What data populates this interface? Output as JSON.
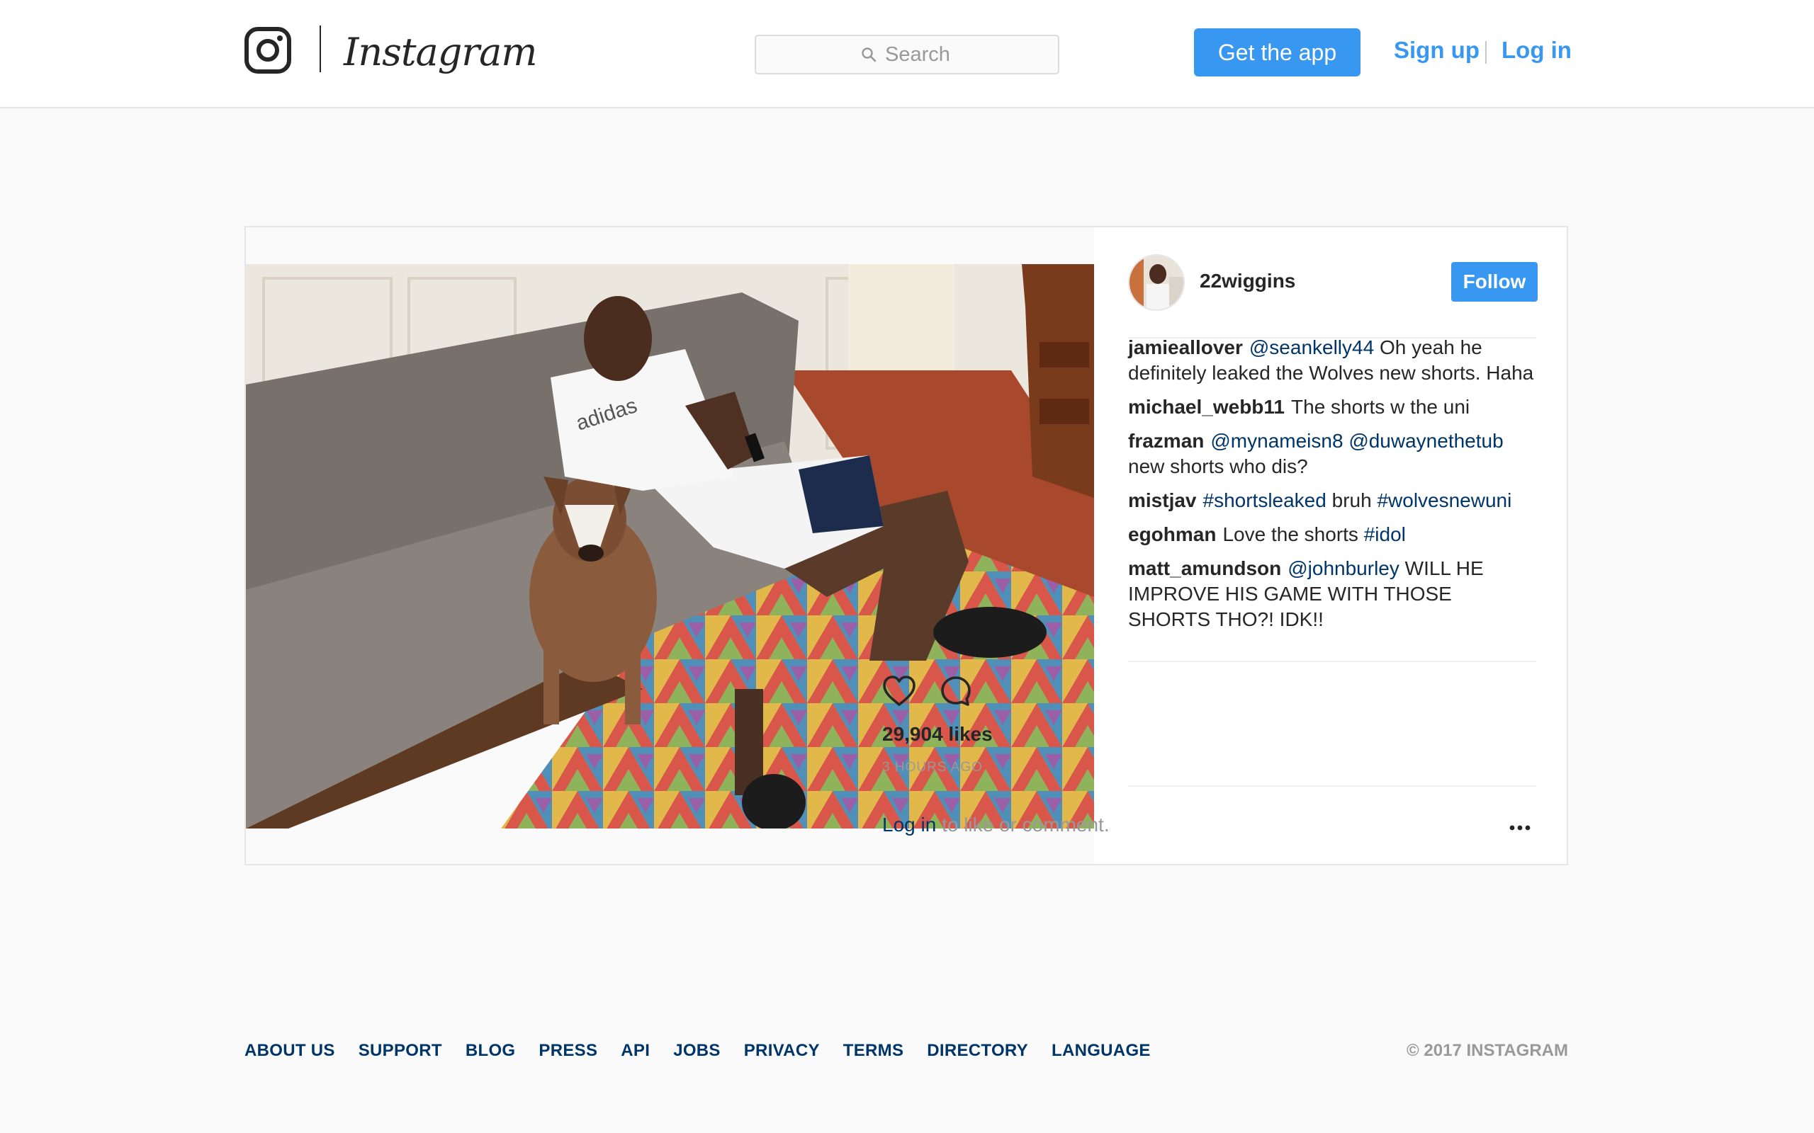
{
  "header": {
    "brand": "Instagram",
    "search_placeholder": "Search",
    "get_app_label": "Get the app",
    "signup_label": "Sign up",
    "login_label": "Log in"
  },
  "post": {
    "author": "22wiggins",
    "follow_label": "Follow",
    "image_logo_text": "adidas",
    "comments": [
      {
        "user": "jamieallover",
        "parts": [
          {
            "t": "@seankelly44",
            "link": true
          },
          {
            "t": " Oh yeah he definitely leaked the Wolves new shorts. Haha",
            "link": false
          }
        ]
      },
      {
        "user": "michael_webb11",
        "parts": [
          {
            "t": "The shorts w the uni",
            "link": false
          }
        ]
      },
      {
        "user": "frazman",
        "parts": [
          {
            "t": "@mynameisn8",
            "link": true
          },
          {
            "t": " ",
            "link": false
          },
          {
            "t": "@duwaynethetub",
            "link": true
          },
          {
            "t": " new shorts who dis?",
            "link": false
          }
        ]
      },
      {
        "user": "mistjav",
        "parts": [
          {
            "t": "#shortsleaked",
            "link": true
          },
          {
            "t": " bruh ",
            "link": false
          },
          {
            "t": "#wolvesnewuni",
            "link": true
          }
        ]
      },
      {
        "user": "egohman",
        "parts": [
          {
            "t": "Love the shorts ",
            "link": false
          },
          {
            "t": "#idol",
            "link": true
          }
        ]
      },
      {
        "user": "matt_amundson",
        "parts": [
          {
            "t": "@johnburley",
            "link": true
          },
          {
            "t": " WILL HE IMPROVE HIS GAME WITH THOSE SHORTS THO?! IDK!!",
            "link": false
          }
        ]
      }
    ],
    "likes": "29,904 likes",
    "time_ago": "3 HOURS AGO",
    "login_link": "Log in",
    "login_suffix": " to like or comment."
  },
  "footer": {
    "links": [
      "ABOUT US",
      "SUPPORT",
      "BLOG",
      "PRESS",
      "API",
      "JOBS",
      "PRIVACY",
      "TERMS",
      "DIRECTORY",
      "LANGUAGE"
    ],
    "copyright": "© 2017 INSTAGRAM"
  },
  "colors": {
    "accent": "#3897f0",
    "link_dark": "#003569",
    "muted": "#999999",
    "text": "#262626",
    "page_bg": "#fafafa"
  },
  "icons": [
    "instagram-glyph-icon",
    "search-icon",
    "heart-icon",
    "comment-icon",
    "more-options-icon"
  ]
}
